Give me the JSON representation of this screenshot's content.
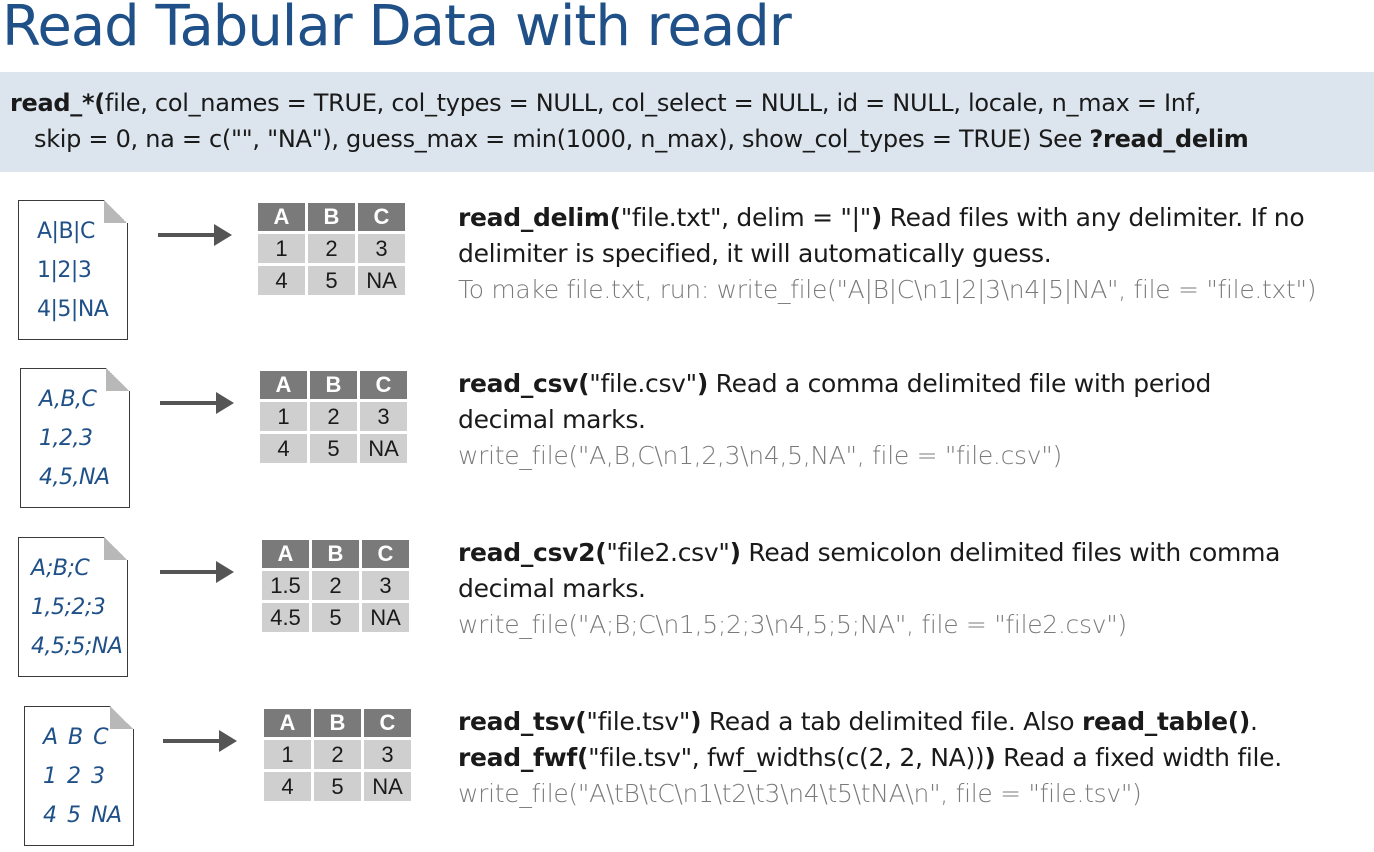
{
  "title": "Read Tabular Data with readr",
  "signature": {
    "fn": "read_*(",
    "args1": "file, col_names = TRUE, col_types = NULL, col_select = NULL, id = NULL, locale, n_max = Inf,",
    "args2": "skip = 0, na = c(\"\", \"NA\"), guess_max = min(1000, n_max), show_col_types = TRUE) See ",
    "see": "?read_delim"
  },
  "sections": [
    {
      "file_lines": [
        "A|B|C",
        "1|2|3",
        "4|5|NA"
      ],
      "table": {
        "headers": [
          "A",
          "B",
          "C"
        ],
        "rows": [
          [
            "1",
            "2",
            "3"
          ],
          [
            "4",
            "5",
            "NA"
          ]
        ]
      },
      "line1": {
        "fn": "read_delim(",
        "args": "\"file.txt\", delim = \"|\"",
        "close": ")",
        "text": " Read files with any delimiter. If no"
      },
      "line2": "delimiter is specified, it will automatically guess.",
      "example": "To make file.txt, run: write_file(\"A|B|C\\n1|2|3\\n4|5|NA\", file = \"file.txt\")"
    },
    {
      "file_lines": [
        "A,B,C",
        "1,2,3",
        "4,5,NA"
      ],
      "table": {
        "headers": [
          "A",
          "B",
          "C"
        ],
        "rows": [
          [
            "1",
            "2",
            "3"
          ],
          [
            "4",
            "5",
            "NA"
          ]
        ]
      },
      "line1": {
        "fn": "read_csv(",
        "args": "\"file.csv\"",
        "close": ")",
        "text": " Read a comma delimited file with period"
      },
      "line2": "decimal marks.",
      "example": "write_file(\"A,B,C\\n1,2,3\\n4,5,NA\", file = \"file.csv\")"
    },
    {
      "file_lines": [
        "A;B;C",
        "1,5;2;3",
        "4,5;5;NA"
      ],
      "table": {
        "headers": [
          "A",
          "B",
          "C"
        ],
        "rows": [
          [
            "1.5",
            "2",
            "3"
          ],
          [
            "4.5",
            "5",
            "NA"
          ]
        ]
      },
      "line1": {
        "fn": "read_csv2(",
        "args": "\"file2.csv\"",
        "close": ")",
        "text": " Read semicolon delimited files with comma"
      },
      "line2": "decimal marks.",
      "example": "write_file(\"A;B;C\\n1,5;2;3\\n4,5;5;NA\", file = \"file2.csv\")"
    },
    {
      "file_lines": [
        "A B C",
        "1 2 3",
        "4 5 NA"
      ],
      "table": {
        "headers": [
          "A",
          "B",
          "C"
        ],
        "rows": [
          [
            "1",
            "2",
            "3"
          ],
          [
            "4",
            "5",
            "NA"
          ]
        ]
      },
      "line1": {
        "fn": "read_tsv(",
        "args": "\"file.tsv\"",
        "close": ")",
        "text": " Read a tab delimited file. Also ",
        "fn2": "read_table()",
        "text2": "."
      },
      "line2b": {
        "fn": "read_fwf(",
        "args": "\"file.tsv\", fwf_widths(c(2, 2, NA))",
        "close": ")",
        "text": " Read a fixed width file."
      },
      "example": "write_file(\"A\\tB\\tC\\n1\\t2\\t3\\n4\\t5\\tNA\\n\", file = \"file.tsv\")"
    }
  ]
}
